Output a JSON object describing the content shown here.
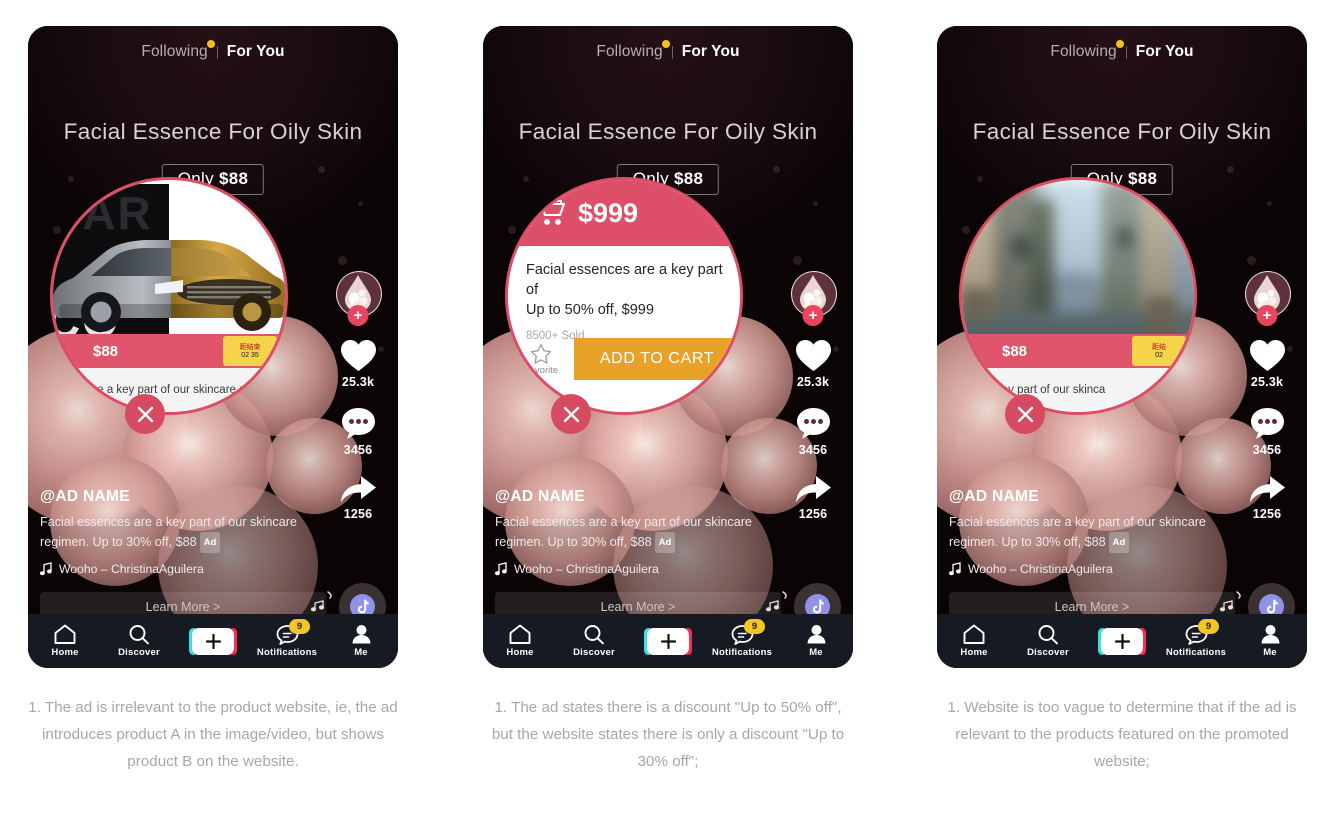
{
  "app": {
    "tabs": {
      "following": "Following",
      "for_you": "For You"
    },
    "hero_title": "Facial Essence For Oily Skin",
    "only_prefix": "Only ",
    "only_price": "$88",
    "ad_name": "@AD NAME",
    "ad_caption": "Facial essences are a key part of our skincare regimen. Up to 30% off, $88",
    "ad_chip": "Ad",
    "music": "Wooho – ChristinaAguilera",
    "learn_more": "Learn More >",
    "rail": {
      "like_count": "25.3k",
      "comment_count": "3456",
      "share_count": "1256"
    },
    "nav": [
      {
        "label": "Home",
        "icon": "home-icon",
        "badge": ""
      },
      {
        "label": "Discover",
        "icon": "search-icon",
        "badge": ""
      },
      {
        "label": "",
        "icon": "plus-icon",
        "badge": ""
      },
      {
        "label": "Notifications",
        "icon": "message-icon",
        "badge": "9"
      },
      {
        "label": "Me",
        "icon": "person-icon",
        "badge": ""
      }
    ],
    "colors": {
      "accent_pink": "#dd4f68",
      "badge_yellow": "#f3c623",
      "cart_orange": "#e8a229",
      "disc_purple": "#8f92e6"
    }
  },
  "panels": [
    {
      "id": "panel-1",
      "magnifier_kind": "car-landing-page",
      "car_word_top": "CAR",
      "car_word_bottom": "CO",
      "price_bar": "$88",
      "tag_line1": "距结束",
      "tag_line2": "02 35",
      "strip_text": "are a key part of our skincare regimen.",
      "description": "1. The ad is irrelevant to the product website, ie, the ad introduces product A in the image/video, but shows product B on the website."
    },
    {
      "id": "panel-2",
      "magnifier_kind": "product-detail-card",
      "card_price": "$999",
      "card_desc_line1": "Facial essences are a key part of",
      "card_desc_line2": "Up to 50% off, $999",
      "card_sold": "8500+ Sold",
      "card_fav_label": "Favorite",
      "card_cart_label": "ADD TO CART",
      "description": "1. The ad states there is a discount \"Up to 50% off\", but the website states there is only a discount \"Up to 30% off\";"
    },
    {
      "id": "panel-3",
      "magnifier_kind": "blurred-street-photo",
      "price_bar": "$88",
      "tag_line1": "距结",
      "tag_line2": "02",
      "strip_text": "key part of our skinca",
      "description": "1. Website is too vague to determine that if the ad is relevant to the products featured on the promoted website;"
    }
  ]
}
